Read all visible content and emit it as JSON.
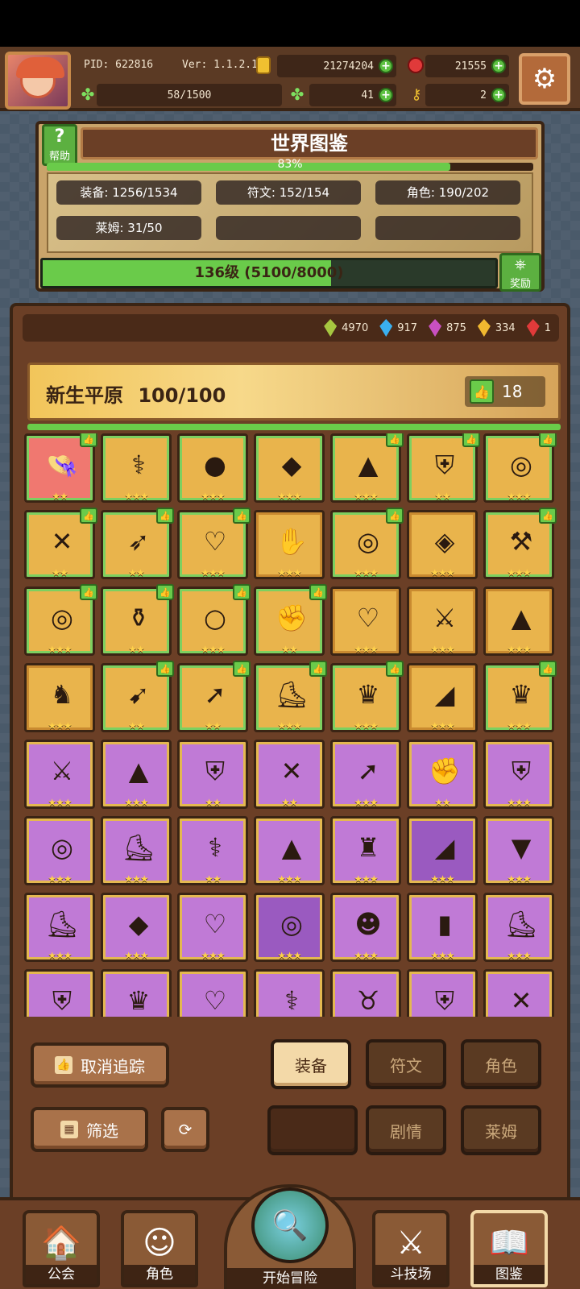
{
  "topbar": {
    "pid": "PID: 622816",
    "version": "Ver: 1.1.2.1",
    "gold": "21274204",
    "ruby": "21555",
    "energy": "58/1500",
    "clover": "41",
    "key": "2"
  },
  "world": {
    "title": "世界图鉴",
    "help_label": "帮助",
    "percent": "83%",
    "percent_value": 83,
    "chips": [
      "装备: 1256/1534",
      "符文: 152/154",
      "角色: 190/202",
      "莱姆: 31/50"
    ],
    "level_text": "136级 (5100/8000)",
    "level_fill": 63.75,
    "reward_label": "奖励"
  },
  "gems": [
    {
      "value": "4970",
      "color": "#a6c640"
    },
    {
      "value": "917",
      "color": "#3ab0f0"
    },
    {
      "value": "875",
      "color": "#c850c0"
    },
    {
      "value": "334",
      "color": "#f0b830"
    },
    {
      "value": "1",
      "color": "#e03a3a"
    }
  ],
  "area": {
    "name": "新生平原",
    "progress": "100/100",
    "likes": "18"
  },
  "items": [
    {
      "t": "red",
      "i": "hat-icon",
      "g": "👒",
      "s": "★★",
      "b": true
    },
    {
      "t": "gold",
      "i": "staff-icon",
      "g": "⚕",
      "s": "★★★",
      "b": false
    },
    {
      "t": "gold",
      "i": "orb-icon",
      "g": "●",
      "s": "★★★",
      "b": false
    },
    {
      "t": "gold",
      "i": "gem-icon",
      "g": "◆",
      "s": "★★★",
      "b": false
    },
    {
      "t": "gold",
      "i": "hood-icon",
      "g": "▲",
      "s": "★★★",
      "b": true
    },
    {
      "t": "gold",
      "i": "armor-icon",
      "g": "⛨",
      "s": "★★",
      "b": true
    },
    {
      "t": "gold",
      "i": "ring-icon",
      "g": "◎",
      "s": "★★★",
      "b": true
    },
    {
      "t": "gold",
      "i": "crossbow-icon",
      "g": "✕",
      "s": "★★",
      "b": true
    },
    {
      "t": "gold",
      "i": "spear-icon",
      "g": "➶",
      "s": "★★",
      "b": true
    },
    {
      "t": "gold",
      "i": "necklace-icon",
      "g": "♡",
      "s": "★★★",
      "b": true
    },
    {
      "t": "gold plain",
      "i": "gauntlet-icon",
      "g": "✋",
      "s": "★★★",
      "b": false
    },
    {
      "t": "gold",
      "i": "bracelet-icon",
      "g": "◎",
      "s": "★★★",
      "b": true
    },
    {
      "t": "gold plain",
      "i": "amulet-icon",
      "g": "◈",
      "s": "★★★",
      "b": false
    },
    {
      "t": "gold",
      "i": "axe-icon",
      "g": "⚒",
      "s": "★★★",
      "b": true
    },
    {
      "t": "gold",
      "i": "ring-icon",
      "g": "◎",
      "s": "★★★",
      "b": true
    },
    {
      "t": "gold",
      "i": "pot-icon",
      "g": "⚱",
      "s": "★★",
      "b": true
    },
    {
      "t": "gold",
      "i": "pearl-icon",
      "g": "○",
      "s": "★★★",
      "b": true
    },
    {
      "t": "gold",
      "i": "glove-icon",
      "g": "✊",
      "s": "★★",
      "b": true
    },
    {
      "t": "gold plain",
      "i": "necklace-icon",
      "g": "♡",
      "s": "★★★",
      "b": false
    },
    {
      "t": "gold plain",
      "i": "sword-icon",
      "g": "⚔",
      "s": "★★★",
      "b": false
    },
    {
      "t": "gold plain",
      "i": "cloak-icon",
      "g": "▲",
      "s": "★★★",
      "b": false
    },
    {
      "t": "gold plain",
      "i": "demon-armor-icon",
      "g": "♞",
      "s": "★★★",
      "b": false
    },
    {
      "t": "gold",
      "i": "bow-icon",
      "g": "➹",
      "s": "★★",
      "b": true
    },
    {
      "t": "gold",
      "i": "arrow-icon",
      "g": "➚",
      "s": "★★",
      "b": true
    },
    {
      "t": "gold",
      "i": "boots-icon",
      "g": "⛸",
      "s": "★★★",
      "b": true
    },
    {
      "t": "gold",
      "i": "crown-icon",
      "g": "♛",
      "s": "★★★",
      "b": true
    },
    {
      "t": "gold plain",
      "i": "bracer-icon",
      "g": "◢",
      "s": "★★★",
      "b": false
    },
    {
      "t": "gold",
      "i": "helmet-icon",
      "g": "♛",
      "s": "★★★",
      "b": true
    },
    {
      "t": "purple",
      "i": "sword-icon",
      "g": "⚔",
      "s": "★★★",
      "b": false
    },
    {
      "t": "purple",
      "i": "hood-icon",
      "g": "▲",
      "s": "★★★",
      "b": false
    },
    {
      "t": "purple",
      "i": "tunic-icon",
      "g": "⛨",
      "s": "★★",
      "b": false
    },
    {
      "t": "purple",
      "i": "crossbow-icon",
      "g": "✕",
      "s": "★★",
      "b": false
    },
    {
      "t": "purple",
      "i": "arrow-icon",
      "g": "➚",
      "s": "★★★",
      "b": false
    },
    {
      "t": "purple",
      "i": "glove-icon",
      "g": "✊",
      "s": "★★",
      "b": false
    },
    {
      "t": "purple",
      "i": "armor-icon",
      "g": "⛨",
      "s": "★★★",
      "b": false
    },
    {
      "t": "purple",
      "i": "belt-icon",
      "g": "◎",
      "s": "★★★",
      "b": false
    },
    {
      "t": "purple",
      "i": "boots-icon",
      "g": "⛸",
      "s": "★★★",
      "b": false
    },
    {
      "t": "purple",
      "i": "staff-icon",
      "g": "⚕",
      "s": "★★",
      "b": false
    },
    {
      "t": "purple",
      "i": "wizard-hat-icon",
      "g": "▲",
      "s": "★★★",
      "b": false
    },
    {
      "t": "purple",
      "i": "armor-icon",
      "g": "♜",
      "s": "★★★",
      "b": false
    },
    {
      "t": "purple dark",
      "i": "bracer-icon",
      "g": "◢",
      "s": "★★★",
      "b": false
    },
    {
      "t": "purple",
      "i": "pants-icon",
      "g": "▼",
      "s": "★★★",
      "b": false
    },
    {
      "t": "purple",
      "i": "boots-icon",
      "g": "⛸",
      "s": "★★★",
      "b": false
    },
    {
      "t": "purple",
      "i": "gem-icon",
      "g": "◆",
      "s": "★★★",
      "b": false
    },
    {
      "t": "purple",
      "i": "necklace-icon",
      "g": "♡",
      "s": "★★★",
      "b": false
    },
    {
      "t": "purple dark",
      "i": "ring-icon",
      "g": "◎",
      "s": "★★★",
      "b": false
    },
    {
      "t": "purple",
      "i": "mask-icon",
      "g": "☻",
      "s": "★★★",
      "b": false
    },
    {
      "t": "purple",
      "i": "robe-icon",
      "g": "▮",
      "s": "★★★",
      "b": false
    },
    {
      "t": "purple",
      "i": "boots-icon",
      "g": "⛸",
      "s": "★★★",
      "b": false
    },
    {
      "t": "purple",
      "i": "armor-icon",
      "g": "⛨",
      "s": "",
      "b": false
    },
    {
      "t": "purple",
      "i": "helmet-icon",
      "g": "♛",
      "s": "",
      "b": false
    },
    {
      "t": "purple",
      "i": "necklace-icon",
      "g": "♡",
      "s": "",
      "b": false
    },
    {
      "t": "purple",
      "i": "staff-icon",
      "g": "⚕",
      "s": "",
      "b": false
    },
    {
      "t": "purple",
      "i": "horn-helmet-icon",
      "g": "♉",
      "s": "",
      "b": false
    },
    {
      "t": "purple",
      "i": "armor-icon",
      "g": "⛨",
      "s": "",
      "b": false
    },
    {
      "t": "purple",
      "i": "crossbow-icon",
      "g": "✕",
      "s": "",
      "b": false
    }
  ],
  "controls": {
    "untrack": "取消追踪",
    "filter": "筛选",
    "tabs": {
      "equipment": "装备",
      "rune": "符文",
      "character": "角色",
      "story": "剧情",
      "slime": "莱姆"
    }
  },
  "nav": {
    "guild": "公会",
    "character": "角色",
    "adventure": "开始冒险",
    "arena": "斗技场",
    "codex": "图鉴"
  }
}
